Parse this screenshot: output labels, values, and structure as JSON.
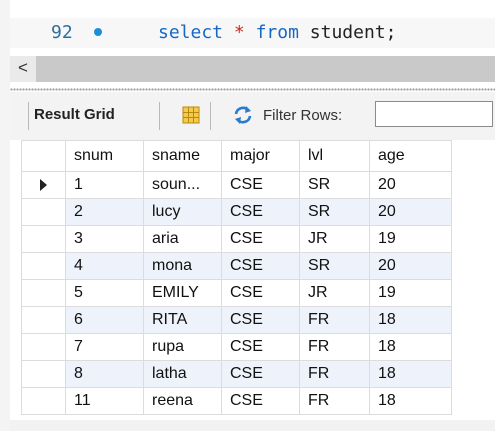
{
  "editor": {
    "line_number": "92",
    "sql_keyword_select": "select",
    "sql_operator": "*",
    "sql_keyword_from": "from",
    "sql_table": "student;"
  },
  "scroll": {
    "left_arrow": "<"
  },
  "toolbar": {
    "result_grid_label": "Result Grid",
    "filter_label": "Filter Rows:",
    "filter_value": ""
  },
  "grid": {
    "columns": [
      "snum",
      "sname",
      "major",
      "lvl",
      "age"
    ],
    "rows": [
      [
        "1",
        "soun...",
        "CSE",
        "SR",
        "20"
      ],
      [
        "2",
        "lucy",
        "CSE",
        "SR",
        "20"
      ],
      [
        "3",
        "aria",
        "CSE",
        "JR",
        "19"
      ],
      [
        "4",
        "mona",
        "CSE",
        "SR",
        "20"
      ],
      [
        "5",
        "EMILY",
        "CSE",
        "JR",
        "19"
      ],
      [
        "6",
        "RITA",
        "CSE",
        "FR",
        "18"
      ],
      [
        "7",
        "rupa",
        "CSE",
        "FR",
        "18"
      ],
      [
        "8",
        "latha",
        "CSE",
        "FR",
        "18"
      ],
      [
        "11",
        "reena",
        "CSE",
        "FR",
        "18"
      ]
    ]
  },
  "colors": {
    "keyword": "#1768c2",
    "operator": "#d0261c",
    "line_number": "#2c6f9a",
    "alt_row": "#eef3fb"
  }
}
